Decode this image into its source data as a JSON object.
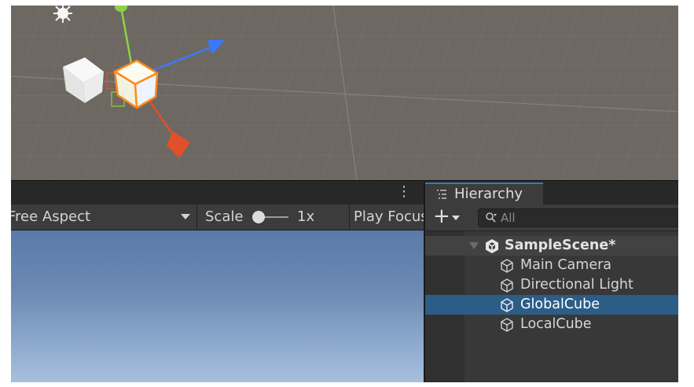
{
  "game_view": {
    "aspect_label": "Free Aspect",
    "scale_label": "Scale",
    "scale_value": "1x",
    "focus_label": "Play Focused"
  },
  "hierarchy": {
    "tab_label": "Hierarchy",
    "add_label": "+",
    "search_placeholder": "All",
    "scene_name": "SampleScene*",
    "items": [
      {
        "label": "Main Camera",
        "selected": false
      },
      {
        "label": "Directional Light",
        "selected": false
      },
      {
        "label": "GlobalCube",
        "selected": true
      },
      {
        "label": "LocalCube",
        "selected": false
      }
    ]
  },
  "colors": {
    "selection": "#2c5d87",
    "tab_accent": "#3a79c4",
    "x_axis": "#e0502a",
    "y_axis": "#8fd14a",
    "z_axis": "#3a79ff",
    "selection_outline": "#ff8a1e"
  },
  "icons": {
    "light": "sun-icon",
    "game_object": "cube-outline-icon",
    "scene": "unity-logo-icon",
    "search": "search-icon"
  }
}
